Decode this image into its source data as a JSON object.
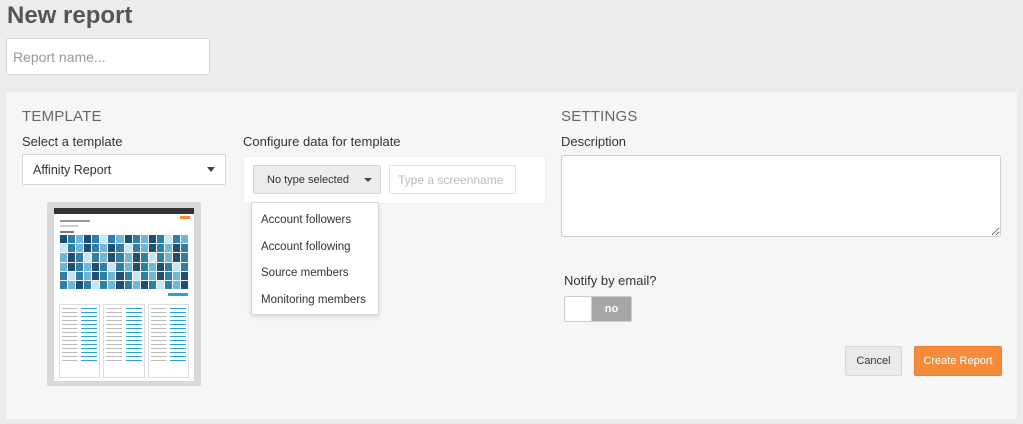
{
  "page": {
    "title": "New report"
  },
  "report_name": {
    "placeholder": "Report name..."
  },
  "template": {
    "heading": "TEMPLATE",
    "select_label": "Select a template",
    "selected": "Affinity Report",
    "configure_label": "Configure data for template",
    "type_select": "No type selected",
    "screenname_placeholder": "Type a screenname",
    "type_options": [
      "Account followers",
      "Account following",
      "Source members",
      "Monitoring members"
    ]
  },
  "settings": {
    "heading": "SETTINGS",
    "description_label": "Description",
    "notify_label": "Notify by email?",
    "notify_value": "no"
  },
  "actions": {
    "cancel": "Cancel",
    "create": "Create Report"
  },
  "colors": {
    "accent": "#f68b3c",
    "toggle_off": "#a6a6a6"
  }
}
